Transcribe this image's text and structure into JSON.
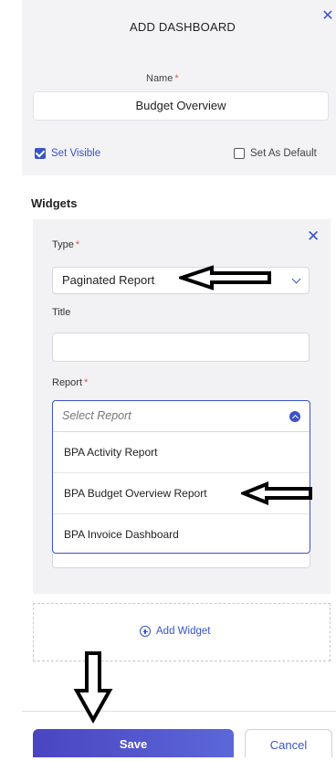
{
  "dialog": {
    "title": "ADD DASHBOARD",
    "close_icon": "close-icon"
  },
  "name_field": {
    "label": "Name",
    "required_mark": "*",
    "value": "Budget Overview"
  },
  "options": {
    "set_visible": {
      "label": "Set Visible",
      "checked": true
    },
    "set_default": {
      "label": "Set As Default",
      "checked": false
    }
  },
  "widgets": {
    "heading": "Widgets",
    "type": {
      "label": "Type",
      "required_mark": "*",
      "value": "Paginated Report"
    },
    "title_field": {
      "label": "Title",
      "value": ""
    },
    "report": {
      "label": "Report",
      "required_mark": "*",
      "placeholder": "Select Report",
      "options": [
        "BPA Activity Report",
        "BPA Budget Overview Report",
        "BPA Invoice Dashboard"
      ]
    },
    "add_widget_label": "Add Widget"
  },
  "footer": {
    "save_label": "Save",
    "cancel_label": "Cancel"
  },
  "colors": {
    "accent": "#3b53c9",
    "save_gradient_start": "#4a45c2",
    "required": "#d9534f",
    "panel_bg": "#f3f3f6"
  }
}
